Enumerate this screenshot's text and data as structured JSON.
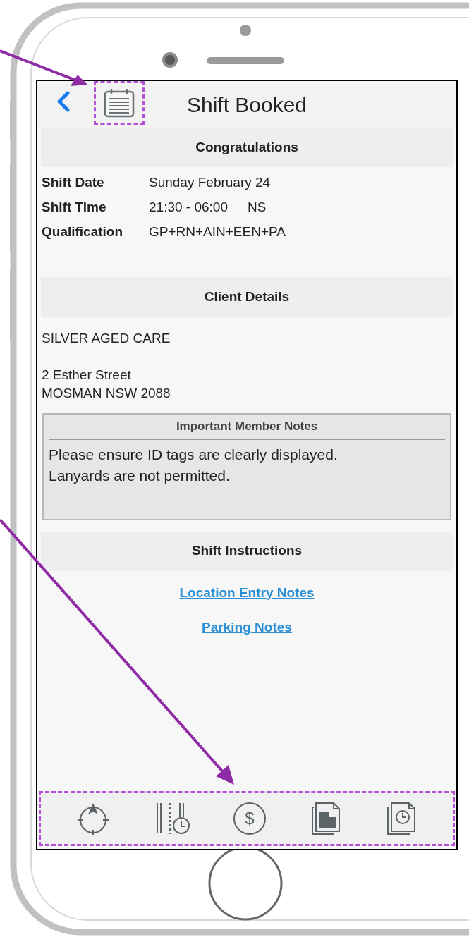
{
  "header": {
    "title": "Shift Booked"
  },
  "congratulations": {
    "heading": "Congratulations",
    "rows": [
      {
        "label": "Shift Date",
        "value": "Sunday February 24"
      },
      {
        "label": "Shift Time",
        "value": "21:30 - 06:00",
        "extra": "NS"
      },
      {
        "label": "Qualification",
        "value": "GP+RN+AIN+EEN+PA"
      }
    ]
  },
  "client": {
    "heading": "Client Details",
    "name": "SILVER AGED CARE",
    "address": [
      "2 Esther Street",
      "MOSMAN NSW 2088"
    ]
  },
  "member_notes": {
    "title": "Important Member Notes",
    "lines": [
      "Please ensure ID tags are clearly displayed.",
      "Lanyards are not permitted."
    ]
  },
  "instructions": {
    "heading": "Shift Instructions",
    "links": [
      "Location Entry Notes",
      "Parking Notes"
    ]
  },
  "tab_bar": [
    {
      "kind": "locate"
    },
    {
      "kind": "timesheet"
    },
    {
      "kind": "pay",
      "symbol": "$"
    },
    {
      "kind": "facility"
    },
    {
      "kind": "history"
    }
  ]
}
